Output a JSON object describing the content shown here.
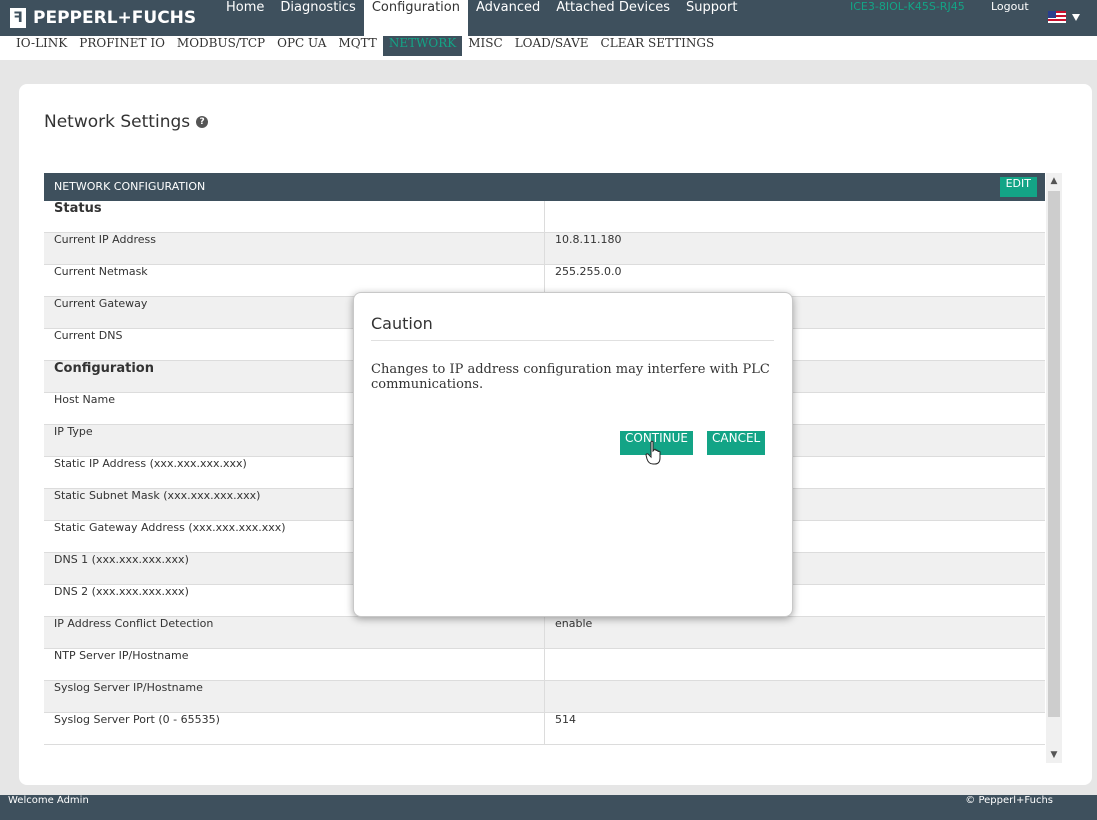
{
  "brand": {
    "name": "PEPPERL+FUCHS",
    "mark": "ꟻ"
  },
  "topnav": {
    "items": [
      "Home",
      "Diagnostics",
      "Configuration",
      "Advanced",
      "Attached Devices",
      "Support"
    ],
    "active": "Configuration",
    "device_name": "ICE3-8IOL-K45S-RJ45",
    "logout": "Logout"
  },
  "subnav": {
    "items": [
      "IO-LINK",
      "PROFINET IO",
      "MODBUS/TCP",
      "OPC UA",
      "MQTT",
      "NETWORK",
      "MISC",
      "LOAD/SAVE",
      "CLEAR SETTINGS"
    ],
    "active": "NETWORK"
  },
  "page": {
    "title": "Network Settings",
    "help_icon": "?"
  },
  "table": {
    "header": "NETWORK CONFIGURATION",
    "edit_label": "EDIT",
    "rows": [
      {
        "label": "Status",
        "value": "",
        "section": true
      },
      {
        "label": "Current IP Address",
        "value": "10.8.11.180"
      },
      {
        "label": "Current Netmask",
        "value": "255.255.0.0"
      },
      {
        "label": "Current Gateway",
        "value": ""
      },
      {
        "label": "Current DNS",
        "value": ""
      },
      {
        "label": "Configuration",
        "value": "",
        "section": true
      },
      {
        "label": "Host Name",
        "value": ""
      },
      {
        "label": "IP Type",
        "value": ""
      },
      {
        "label": "Static IP Address (xxx.xxx.xxx.xxx)",
        "value": ""
      },
      {
        "label": "Static Subnet Mask (xxx.xxx.xxx.xxx)",
        "value": ""
      },
      {
        "label": "Static Gateway Address (xxx.xxx.xxx.xxx)",
        "value": ""
      },
      {
        "label": "DNS 1 (xxx.xxx.xxx.xxx)",
        "value": ""
      },
      {
        "label": "DNS 2 (xxx.xxx.xxx.xxx)",
        "value": ""
      },
      {
        "label": "IP Address Conflict Detection",
        "value": "enable"
      },
      {
        "label": "NTP Server IP/Hostname",
        "value": ""
      },
      {
        "label": "Syslog Server IP/Hostname",
        "value": ""
      },
      {
        "label": "Syslog Server Port (0 - 65535)",
        "value": "514"
      }
    ]
  },
  "modal": {
    "title": "Caution",
    "message": "Changes to IP address configuration may interfere with PLC communications.",
    "continue_label": "CONTINUE",
    "cancel_label": "CANCEL"
  },
  "footer": {
    "left": "Welcome Admin",
    "right": "© Pepperl+Fuchs"
  },
  "colors": {
    "nav": "#3e505d",
    "accent": "#13a486"
  },
  "icons": {
    "help": "help-icon",
    "flag": "us-flag-icon",
    "cursor": "hand-pointer-icon"
  }
}
